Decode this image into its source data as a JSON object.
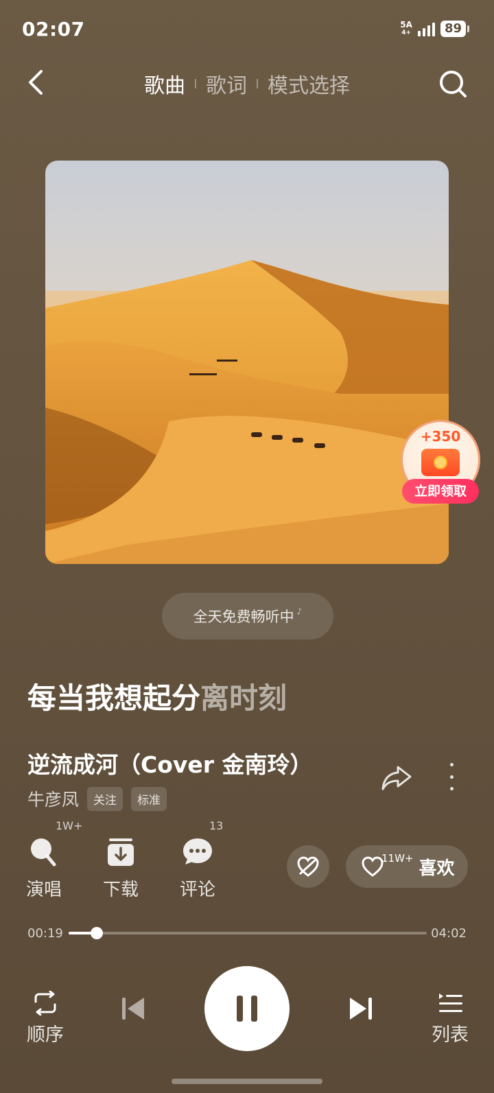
{
  "status_bar": {
    "time": "02:07",
    "network": "5A",
    "network_sub": "4+",
    "battery": "89"
  },
  "header": {
    "tabs": [
      {
        "label": "歌曲",
        "active": true
      },
      {
        "label": "歌词",
        "active": false
      },
      {
        "label": "模式选择",
        "active": false
      }
    ]
  },
  "reward": {
    "amount": "+350",
    "label": "立即领取"
  },
  "free_listen": {
    "text": "全天免费畅听中"
  },
  "lyric": {
    "sung": "每当我想起分",
    "unsung": "离时刻"
  },
  "song": {
    "title": "逆流成河（Cover 金南玲）",
    "artist": "牛彦凤",
    "follow_tag": "关注",
    "quality_tag": "标准"
  },
  "actions": {
    "sing": {
      "label": "演唱",
      "count": "1W+"
    },
    "download": {
      "label": "下载"
    },
    "comment": {
      "label": "评论",
      "count": "13"
    },
    "like": {
      "label": "喜欢",
      "count": "11W+"
    }
  },
  "progress": {
    "current": "00:19",
    "total": "04:02",
    "fraction": 0.079
  },
  "controls": {
    "mode_label": "顺序",
    "list_label": "列表"
  },
  "colors": {
    "background": "#63533f",
    "reward_pill": "#ff3a62",
    "reward_amount": "#ff5a2a"
  }
}
